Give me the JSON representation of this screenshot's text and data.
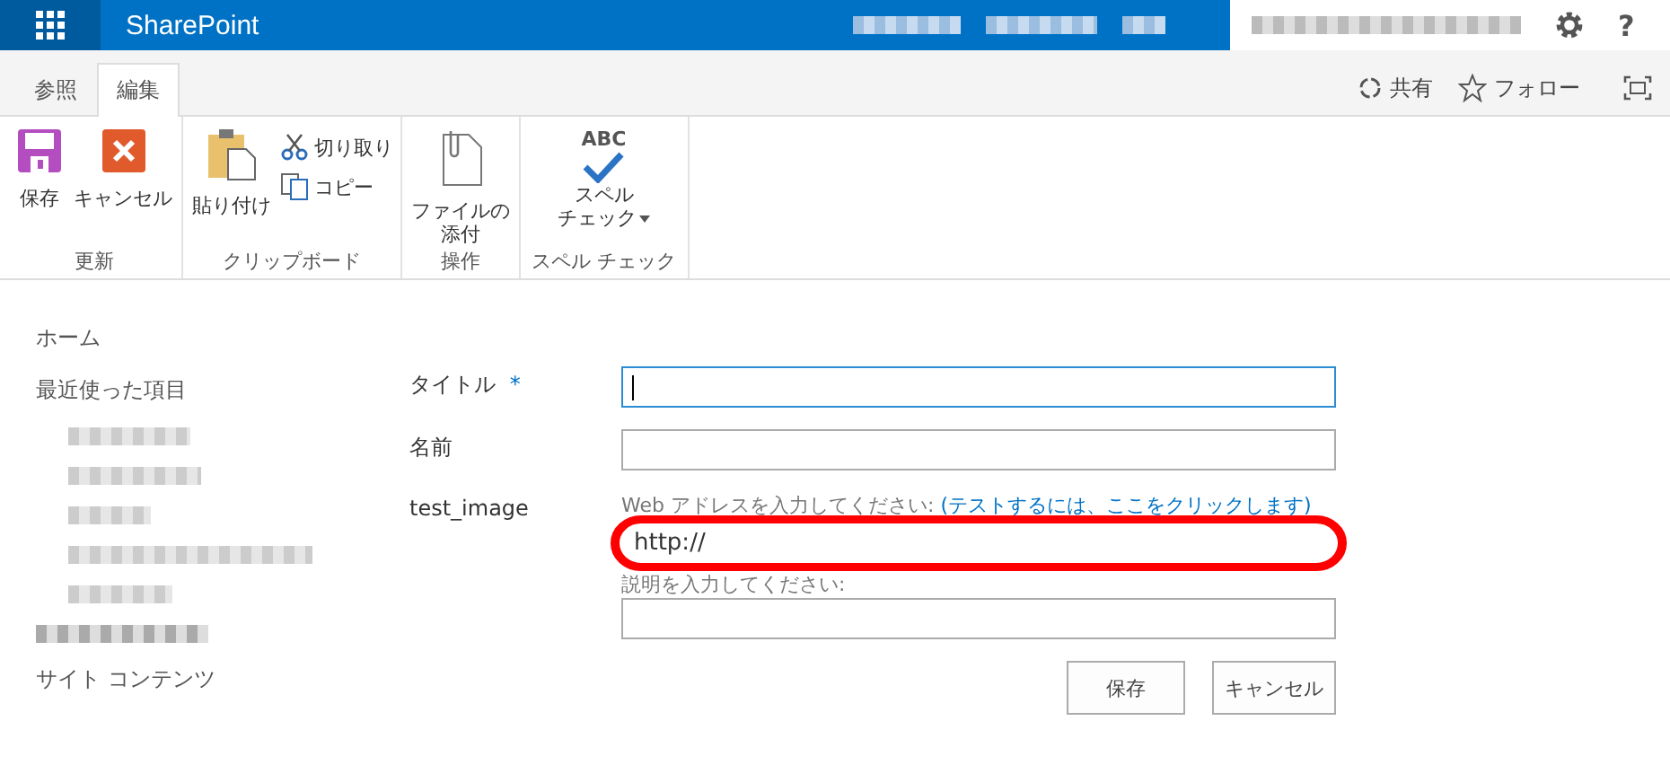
{
  "topbar": {
    "brand": "SharePoint",
    "help": "?"
  },
  "tabs": [
    {
      "label": "参照",
      "selected": false
    },
    {
      "label": "編集",
      "selected": true
    }
  ],
  "actions": [
    {
      "kind": "share",
      "label": "共有"
    },
    {
      "kind": "follow",
      "label": "フォロー"
    },
    {
      "kind": "focus"
    }
  ],
  "ribbon": [
    {
      "group": "更新",
      "commands": [
        {
          "kind": "save",
          "label": "保存"
        },
        {
          "kind": "cancel",
          "label": "キャンセル"
        }
      ]
    },
    {
      "group": "クリップボード",
      "commands": [
        {
          "kind": "paste",
          "label": "貼り付け"
        },
        {
          "kind": "cut",
          "label": "切り取り"
        },
        {
          "kind": "copy",
          "label": "コピー"
        }
      ]
    },
    {
      "group": "操作",
      "commands": [
        {
          "kind": "attach",
          "lines": [
            "ファイルの",
            "添付"
          ]
        }
      ]
    },
    {
      "group": "スペル チェック",
      "commands": [
        {
          "kind": "spell",
          "lines": [
            "スペル",
            "チェック"
          ],
          "badge": "ABC"
        }
      ]
    }
  ],
  "nav": [
    {
      "label": "ホーム"
    },
    {
      "label": "最近使った項目"
    },
    {
      "label": "サイト コンテンツ"
    }
  ],
  "form": {
    "fields": [
      {
        "label": "タイトル",
        "required": "*",
        "kind": "text",
        "focused": true
      },
      {
        "label": "名前",
        "kind": "text",
        "focused": false
      },
      {
        "label": "test_image",
        "kind": "url",
        "hint": "Web アドレスを入力してください:",
        "link": "(テストするには、ここをクリックします)",
        "value": "http://",
        "hint2": "説明を入力してください:",
        "focused": false
      }
    ],
    "buttons": [
      "保存",
      "キャンセル"
    ]
  }
}
